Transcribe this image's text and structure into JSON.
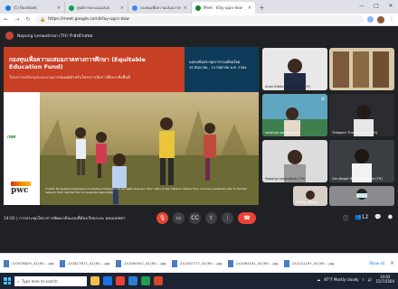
{
  "browser": {
    "tabs": [
      {
        "title": "(1) Facebook",
        "color": "#1877f2",
        "active": false
      },
      {
        "title": "ศูนย์การคะแนนเสมอ",
        "color": "#0f9d58",
        "active": false
      },
      {
        "title": "กองทุนเพื่อความเสมอภาคทางการศึกษา",
        "color": "#4285f4",
        "active": false
      },
      {
        "title": "Meet - kfay-ugcs-dow",
        "color": "#00832d",
        "active": true
      }
    ],
    "url": "https://meet.google.com/kfay-ugcs-dow"
  },
  "meeting": {
    "presenter_label": "Napong Leewutinan (TH) กำลังนำเสนอ",
    "time": "14:02",
    "title": "การประชุมโครงการพัฒนาต้นแบบที่ห้องเรียนระยะ ผลนบตสตา"
  },
  "slide": {
    "title": "กองทุนเพื่อความเสมอภาคทางการศึกษา (Equitable Education Fund)",
    "subtitle": "โครงการปรับปรุงระบบงานสารสนเทศสำหรับโครงการจัดการศึกษาเชิงพื้นที่",
    "date_line1": "นอกเหนือประชุมจากรวมเดือนใหม่",
    "date_line2": "30 มิถุนายน - 15 กันยายน พ.ศ. 2564",
    "logo_left": "กสศ",
    "logo_pwc": "pwc",
    "caption": "© 2021 PricewaterhouseCoopers Consulting (Thailand) Ltd. All rights reserved. 'PwC' refers to the Thailand member firm, and may sometimes refer to the PwC network. Each member firm is a separate legal entity."
  },
  "participants": [
    {
      "name": "Anan Kietbunnangsunt (TH)"
    },
    {
      "name": ""
    },
    {
      "name": "sukanya sangrasang"
    },
    {
      "name": "Thitiporn Thanpongsan (TH)"
    },
    {
      "name": "Napong Leewutinan (TH)"
    },
    {
      "name": "Orn-Napat Boonsarnaphat (TH)"
    },
    {
      "name": "Tailing daouie"
    },
    {
      "name": ""
    }
  ],
  "controls": {
    "mic_icon": "mic-off-icon",
    "cam_icon": "camera-icon",
    "cc_icon": "captions-icon",
    "present_icon": "present-icon",
    "more_icon": "more-icon",
    "end_icon": "phone-hangup-icon",
    "people_count": "12"
  },
  "downloads": [
    "243978829_42165....jpg",
    "243817871_42165....jpg",
    "241590507_42165....jpg",
    "241302777_42165....jpg",
    "241084191_42165....jpg",
    "241241197_42165....jpg"
  ],
  "downloads_showall": "Show all",
  "taskbar": {
    "search_placeholder": "Type here to search",
    "weather": "87°F Mostly cloudy",
    "time": "14:02",
    "date": "15/7/2564"
  }
}
